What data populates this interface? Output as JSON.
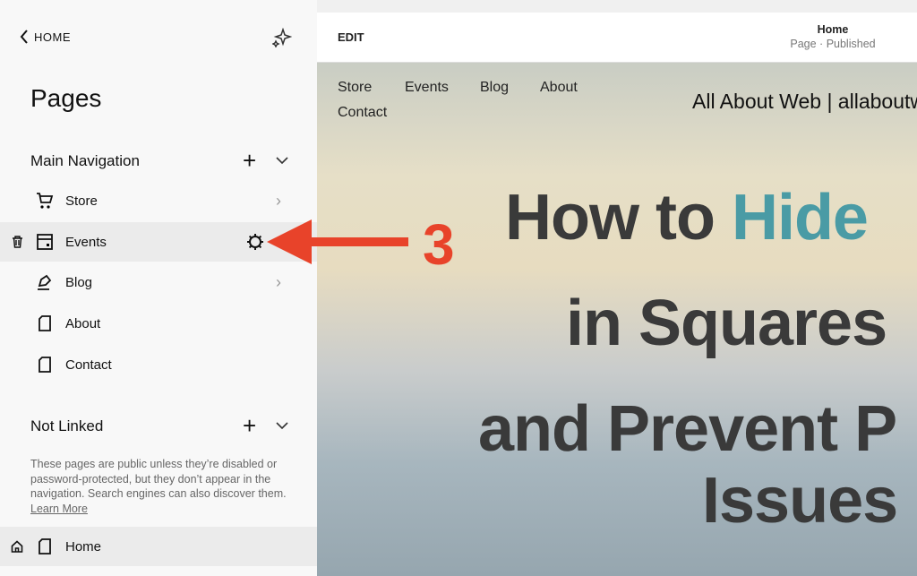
{
  "sidebar": {
    "home_label": "HOME",
    "title": "Pages",
    "main_nav": {
      "label": "Main Navigation",
      "items": [
        {
          "label": "Store",
          "icon": "cart-icon"
        },
        {
          "label": "Events",
          "icon": "calendar-icon"
        },
        {
          "label": "Blog",
          "icon": "pen-icon"
        },
        {
          "label": "About",
          "icon": "page-icon"
        },
        {
          "label": "Contact",
          "icon": "page-icon"
        }
      ]
    },
    "not_linked": {
      "label": "Not Linked",
      "description": "These pages are public unless they’re disabled or password-protected, but they don’t appear in the navigation. Search engines can also discover them.",
      "learn_more": "Learn More",
      "items": [
        {
          "label": "Home",
          "icon": "page-icon"
        }
      ]
    }
  },
  "topbar": {
    "edit_label": "EDIT",
    "page_title": "Home",
    "page_status": "Page · Published"
  },
  "preview": {
    "nav": [
      "Store",
      "Events",
      "Blog",
      "About",
      "Contact"
    ],
    "site_title": "All About Web | allaboutw",
    "headline": {
      "line1a": "How to ",
      "line1b": "Hide",
      "line2": "in Squares",
      "line3": "and Prevent P",
      "line4": "Issues"
    }
  },
  "annotation": {
    "label": "3",
    "color": "#e8432a"
  },
  "colors": {
    "accent": "#4a9ba5",
    "headline": "#3a3a3a"
  }
}
